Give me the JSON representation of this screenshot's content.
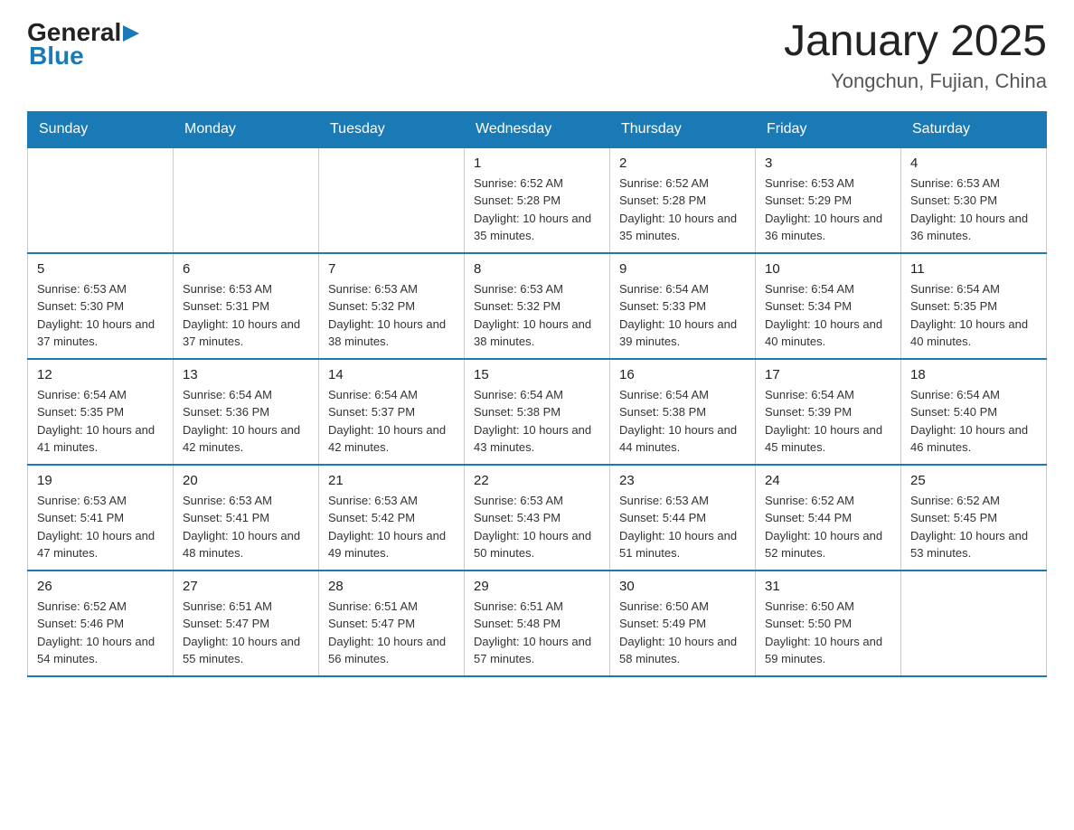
{
  "header": {
    "logo": {
      "general": "General",
      "arrow": "▶",
      "blue": "Blue"
    },
    "title": "January 2025",
    "subtitle": "Yongchun, Fujian, China"
  },
  "calendar": {
    "days_of_week": [
      "Sunday",
      "Monday",
      "Tuesday",
      "Wednesday",
      "Thursday",
      "Friday",
      "Saturday"
    ],
    "weeks": [
      [
        {
          "day": "",
          "info": ""
        },
        {
          "day": "",
          "info": ""
        },
        {
          "day": "",
          "info": ""
        },
        {
          "day": "1",
          "info": "Sunrise: 6:52 AM\nSunset: 5:28 PM\nDaylight: 10 hours and 35 minutes."
        },
        {
          "day": "2",
          "info": "Sunrise: 6:52 AM\nSunset: 5:28 PM\nDaylight: 10 hours and 35 minutes."
        },
        {
          "day": "3",
          "info": "Sunrise: 6:53 AM\nSunset: 5:29 PM\nDaylight: 10 hours and 36 minutes."
        },
        {
          "day": "4",
          "info": "Sunrise: 6:53 AM\nSunset: 5:30 PM\nDaylight: 10 hours and 36 minutes."
        }
      ],
      [
        {
          "day": "5",
          "info": "Sunrise: 6:53 AM\nSunset: 5:30 PM\nDaylight: 10 hours and 37 minutes."
        },
        {
          "day": "6",
          "info": "Sunrise: 6:53 AM\nSunset: 5:31 PM\nDaylight: 10 hours and 37 minutes."
        },
        {
          "day": "7",
          "info": "Sunrise: 6:53 AM\nSunset: 5:32 PM\nDaylight: 10 hours and 38 minutes."
        },
        {
          "day": "8",
          "info": "Sunrise: 6:53 AM\nSunset: 5:32 PM\nDaylight: 10 hours and 38 minutes."
        },
        {
          "day": "9",
          "info": "Sunrise: 6:54 AM\nSunset: 5:33 PM\nDaylight: 10 hours and 39 minutes."
        },
        {
          "day": "10",
          "info": "Sunrise: 6:54 AM\nSunset: 5:34 PM\nDaylight: 10 hours and 40 minutes."
        },
        {
          "day": "11",
          "info": "Sunrise: 6:54 AM\nSunset: 5:35 PM\nDaylight: 10 hours and 40 minutes."
        }
      ],
      [
        {
          "day": "12",
          "info": "Sunrise: 6:54 AM\nSunset: 5:35 PM\nDaylight: 10 hours and 41 minutes."
        },
        {
          "day": "13",
          "info": "Sunrise: 6:54 AM\nSunset: 5:36 PM\nDaylight: 10 hours and 42 minutes."
        },
        {
          "day": "14",
          "info": "Sunrise: 6:54 AM\nSunset: 5:37 PM\nDaylight: 10 hours and 42 minutes."
        },
        {
          "day": "15",
          "info": "Sunrise: 6:54 AM\nSunset: 5:38 PM\nDaylight: 10 hours and 43 minutes."
        },
        {
          "day": "16",
          "info": "Sunrise: 6:54 AM\nSunset: 5:38 PM\nDaylight: 10 hours and 44 minutes."
        },
        {
          "day": "17",
          "info": "Sunrise: 6:54 AM\nSunset: 5:39 PM\nDaylight: 10 hours and 45 minutes."
        },
        {
          "day": "18",
          "info": "Sunrise: 6:54 AM\nSunset: 5:40 PM\nDaylight: 10 hours and 46 minutes."
        }
      ],
      [
        {
          "day": "19",
          "info": "Sunrise: 6:53 AM\nSunset: 5:41 PM\nDaylight: 10 hours and 47 minutes."
        },
        {
          "day": "20",
          "info": "Sunrise: 6:53 AM\nSunset: 5:41 PM\nDaylight: 10 hours and 48 minutes."
        },
        {
          "day": "21",
          "info": "Sunrise: 6:53 AM\nSunset: 5:42 PM\nDaylight: 10 hours and 49 minutes."
        },
        {
          "day": "22",
          "info": "Sunrise: 6:53 AM\nSunset: 5:43 PM\nDaylight: 10 hours and 50 minutes."
        },
        {
          "day": "23",
          "info": "Sunrise: 6:53 AM\nSunset: 5:44 PM\nDaylight: 10 hours and 51 minutes."
        },
        {
          "day": "24",
          "info": "Sunrise: 6:52 AM\nSunset: 5:44 PM\nDaylight: 10 hours and 52 minutes."
        },
        {
          "day": "25",
          "info": "Sunrise: 6:52 AM\nSunset: 5:45 PM\nDaylight: 10 hours and 53 minutes."
        }
      ],
      [
        {
          "day": "26",
          "info": "Sunrise: 6:52 AM\nSunset: 5:46 PM\nDaylight: 10 hours and 54 minutes."
        },
        {
          "day": "27",
          "info": "Sunrise: 6:51 AM\nSunset: 5:47 PM\nDaylight: 10 hours and 55 minutes."
        },
        {
          "day": "28",
          "info": "Sunrise: 6:51 AM\nSunset: 5:47 PM\nDaylight: 10 hours and 56 minutes."
        },
        {
          "day": "29",
          "info": "Sunrise: 6:51 AM\nSunset: 5:48 PM\nDaylight: 10 hours and 57 minutes."
        },
        {
          "day": "30",
          "info": "Sunrise: 6:50 AM\nSunset: 5:49 PM\nDaylight: 10 hours and 58 minutes."
        },
        {
          "day": "31",
          "info": "Sunrise: 6:50 AM\nSunset: 5:50 PM\nDaylight: 10 hours and 59 minutes."
        },
        {
          "day": "",
          "info": ""
        }
      ]
    ]
  }
}
